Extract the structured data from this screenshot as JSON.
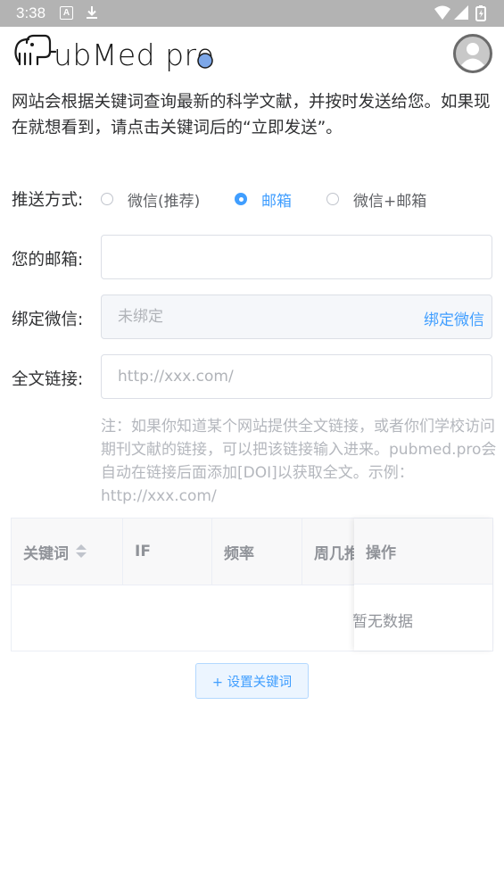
{
  "status_bar": {
    "time": "3:38",
    "notif_a": "A"
  },
  "header": {
    "logo_text": "ubMed pro"
  },
  "description": "网站会根据关键词查询最新的科学文献，并按时发送给您。如果现在就想看到，请点击关键词后的“立即发送”。",
  "form": {
    "push_label": "推送方式:",
    "push_options": [
      {
        "label": "微信(推荐)",
        "checked": false
      },
      {
        "label": "邮箱",
        "checked": true
      },
      {
        "label": "微信+邮箱",
        "checked": false
      }
    ],
    "email_label": "您的邮箱:",
    "email_value": "",
    "wechat_label": "绑定微信:",
    "wechat_placeholder": "未绑定",
    "wechat_bind_link": "绑定微信",
    "fulltext_label": "全文链接:",
    "fulltext_placeholder": "http://xxx.com/",
    "note": "注：如果你知道某个网站提供全文链接，或者你们学校访问期刊文献的链接，可以把该链接输入进来。pubmed.pro会自动在链接后面添加[DOI]以获取全文。示例：http://xxx.com/"
  },
  "table": {
    "columns": [
      "关键词",
      "IF",
      "频率",
      "周几推",
      "操作"
    ],
    "empty_text": "暂无数据"
  },
  "buttons": {
    "set_keywords": "+ 设置关键词"
  },
  "colors": {
    "accent": "#409eff",
    "statusbar": "#b3b3b3"
  }
}
